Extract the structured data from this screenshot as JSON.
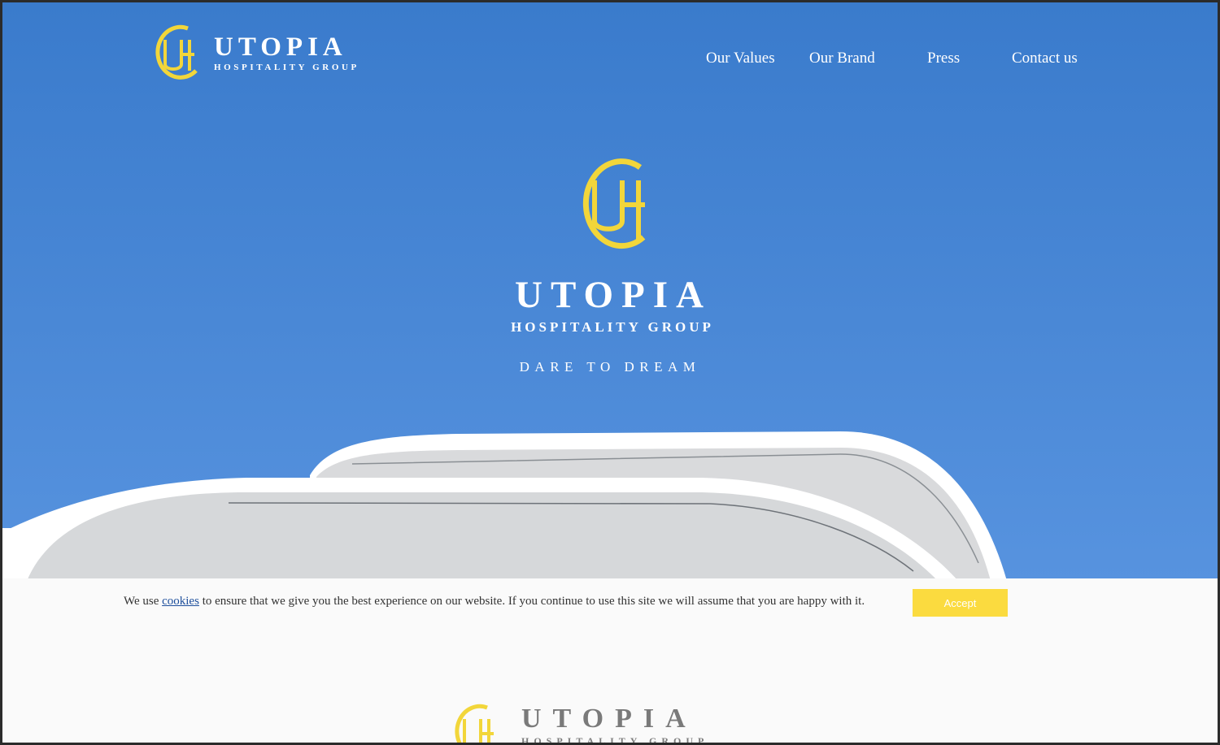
{
  "brand": {
    "name": "UTOPIA",
    "subtitle": "HOSPITALITY GROUP",
    "logo_icon": "uh-monogram-icon"
  },
  "nav": {
    "items": [
      {
        "label": "Our Values"
      },
      {
        "label": "Our Brand"
      },
      {
        "label": "Press"
      },
      {
        "label": "Contact us"
      }
    ]
  },
  "hero": {
    "title": "UTOPIA",
    "subtitle": "HOSPITALITY GROUP",
    "tagline": "DARE TO DREAM"
  },
  "cookie": {
    "text_before": "We use ",
    "link": "cookies",
    "text_after": " to ensure that we give you the best experience on our website. If you continue to use this site we will assume that you are happy with it.",
    "accept_label": "Accept"
  },
  "footer": {
    "name": "UTOPIA",
    "subtitle": "HOSPITALITY GROUP"
  },
  "colors": {
    "sky_blue": "#3a7bcc",
    "logo_yellow": "#f2d63a",
    "accept_yellow": "#fbdb3f",
    "cookie_bg": "#fafafa"
  }
}
